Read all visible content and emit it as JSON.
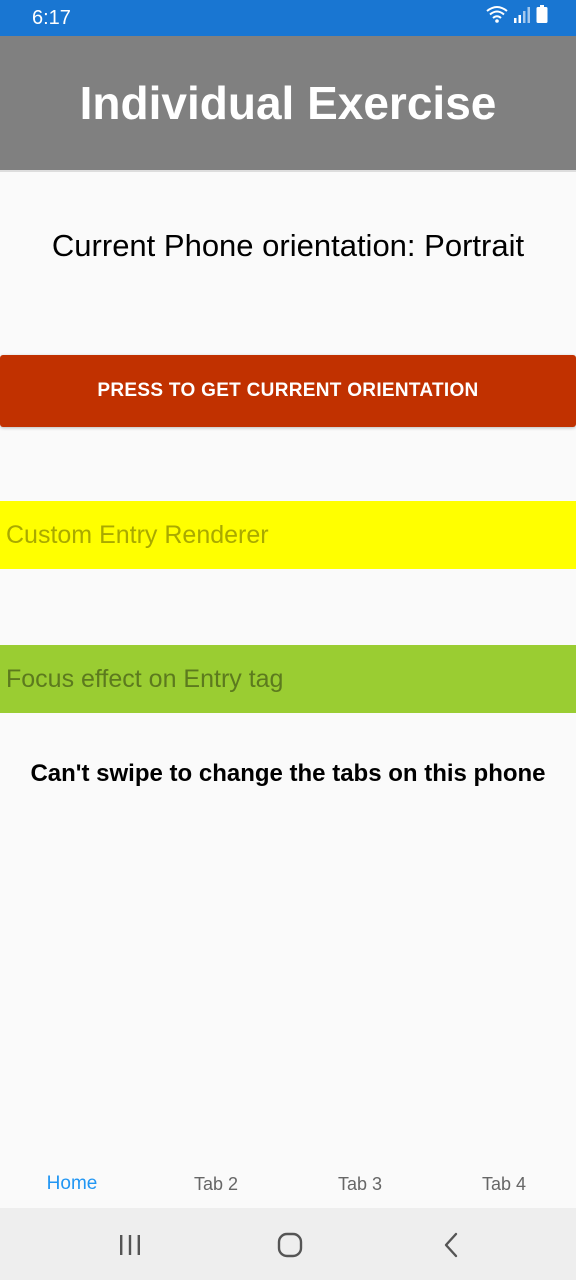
{
  "status_bar": {
    "time": "6:17",
    "icons": [
      "wifi-icon",
      "signal-icon",
      "battery-icon"
    ]
  },
  "header": {
    "title": "Individual Exercise"
  },
  "main": {
    "orientation_text": "Current Phone orientation: Portrait",
    "orientation_button_label": "PRESS TO GET CURRENT ORIENTATION",
    "custom_entry_placeholder": "Custom Entry Renderer",
    "focus_entry_placeholder": "Focus effect on Entry tag",
    "swipe_note": "Can't swipe to change the tabs on this phone"
  },
  "tabs": [
    {
      "label": "Home",
      "active": true
    },
    {
      "label": "Tab 2",
      "active": false
    },
    {
      "label": "Tab 3",
      "active": false
    },
    {
      "label": "Tab 4",
      "active": false
    }
  ],
  "nav_bar": {
    "icons": [
      "recent-apps-icon",
      "home-circle-icon",
      "back-icon"
    ]
  },
  "colors": {
    "status_bar": "#1976D2",
    "title_bar": "#808080",
    "button": "#C13100",
    "entry_yellow": "#FFFF00",
    "entry_green": "#9ACD32",
    "active_tab": "#2196F3"
  }
}
